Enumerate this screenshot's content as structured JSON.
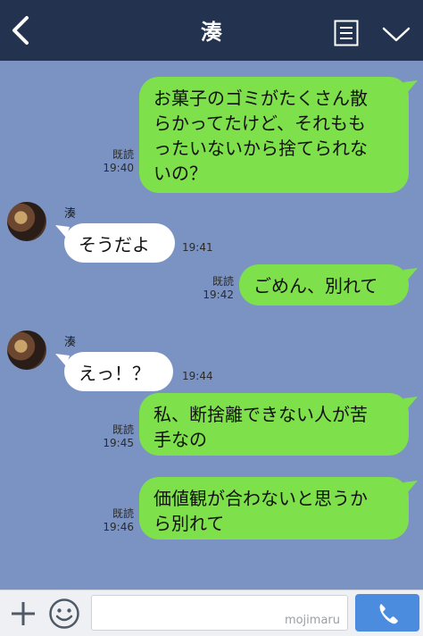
{
  "header": {
    "title": "湊",
    "back_icon": "chevron-left-icon",
    "menu_icon": "menu-list-icon",
    "more_icon": "chevron-down-icon"
  },
  "contact": {
    "name": "湊"
  },
  "messages": [
    {
      "dir": "out",
      "text": "お菓子のゴミがたくさん散\nらかってたけど、それもも\nったいないから捨てられな\nいの？",
      "read": "既読",
      "time": "19:40"
    },
    {
      "dir": "in",
      "text": "そうだよ",
      "time": "19:41",
      "show_name": true
    },
    {
      "dir": "out",
      "text": "ごめん、別れて",
      "read": "既読",
      "time": "19:42"
    },
    {
      "dir": "in",
      "text": "えっ！？",
      "time": "19:44",
      "show_name": true
    },
    {
      "dir": "out",
      "text": "私、断捨離できない人が苦\n手なの",
      "read": "既読",
      "time": "19:45"
    },
    {
      "dir": "out",
      "text": "価値観が合わないと思うか\nら別れて",
      "read": "既読",
      "time": "19:46"
    }
  ],
  "footer": {
    "watermark": "mojimaru",
    "plus_icon": "plus-icon",
    "emoji_icon": "smiley-icon",
    "send_icon": "phone-icon"
  },
  "colors": {
    "header": "#23324e",
    "chat_bg": "#7b93c2",
    "out_bubble": "#7ee04a",
    "in_bubble": "#ffffff",
    "send": "#4b8cdf"
  }
}
